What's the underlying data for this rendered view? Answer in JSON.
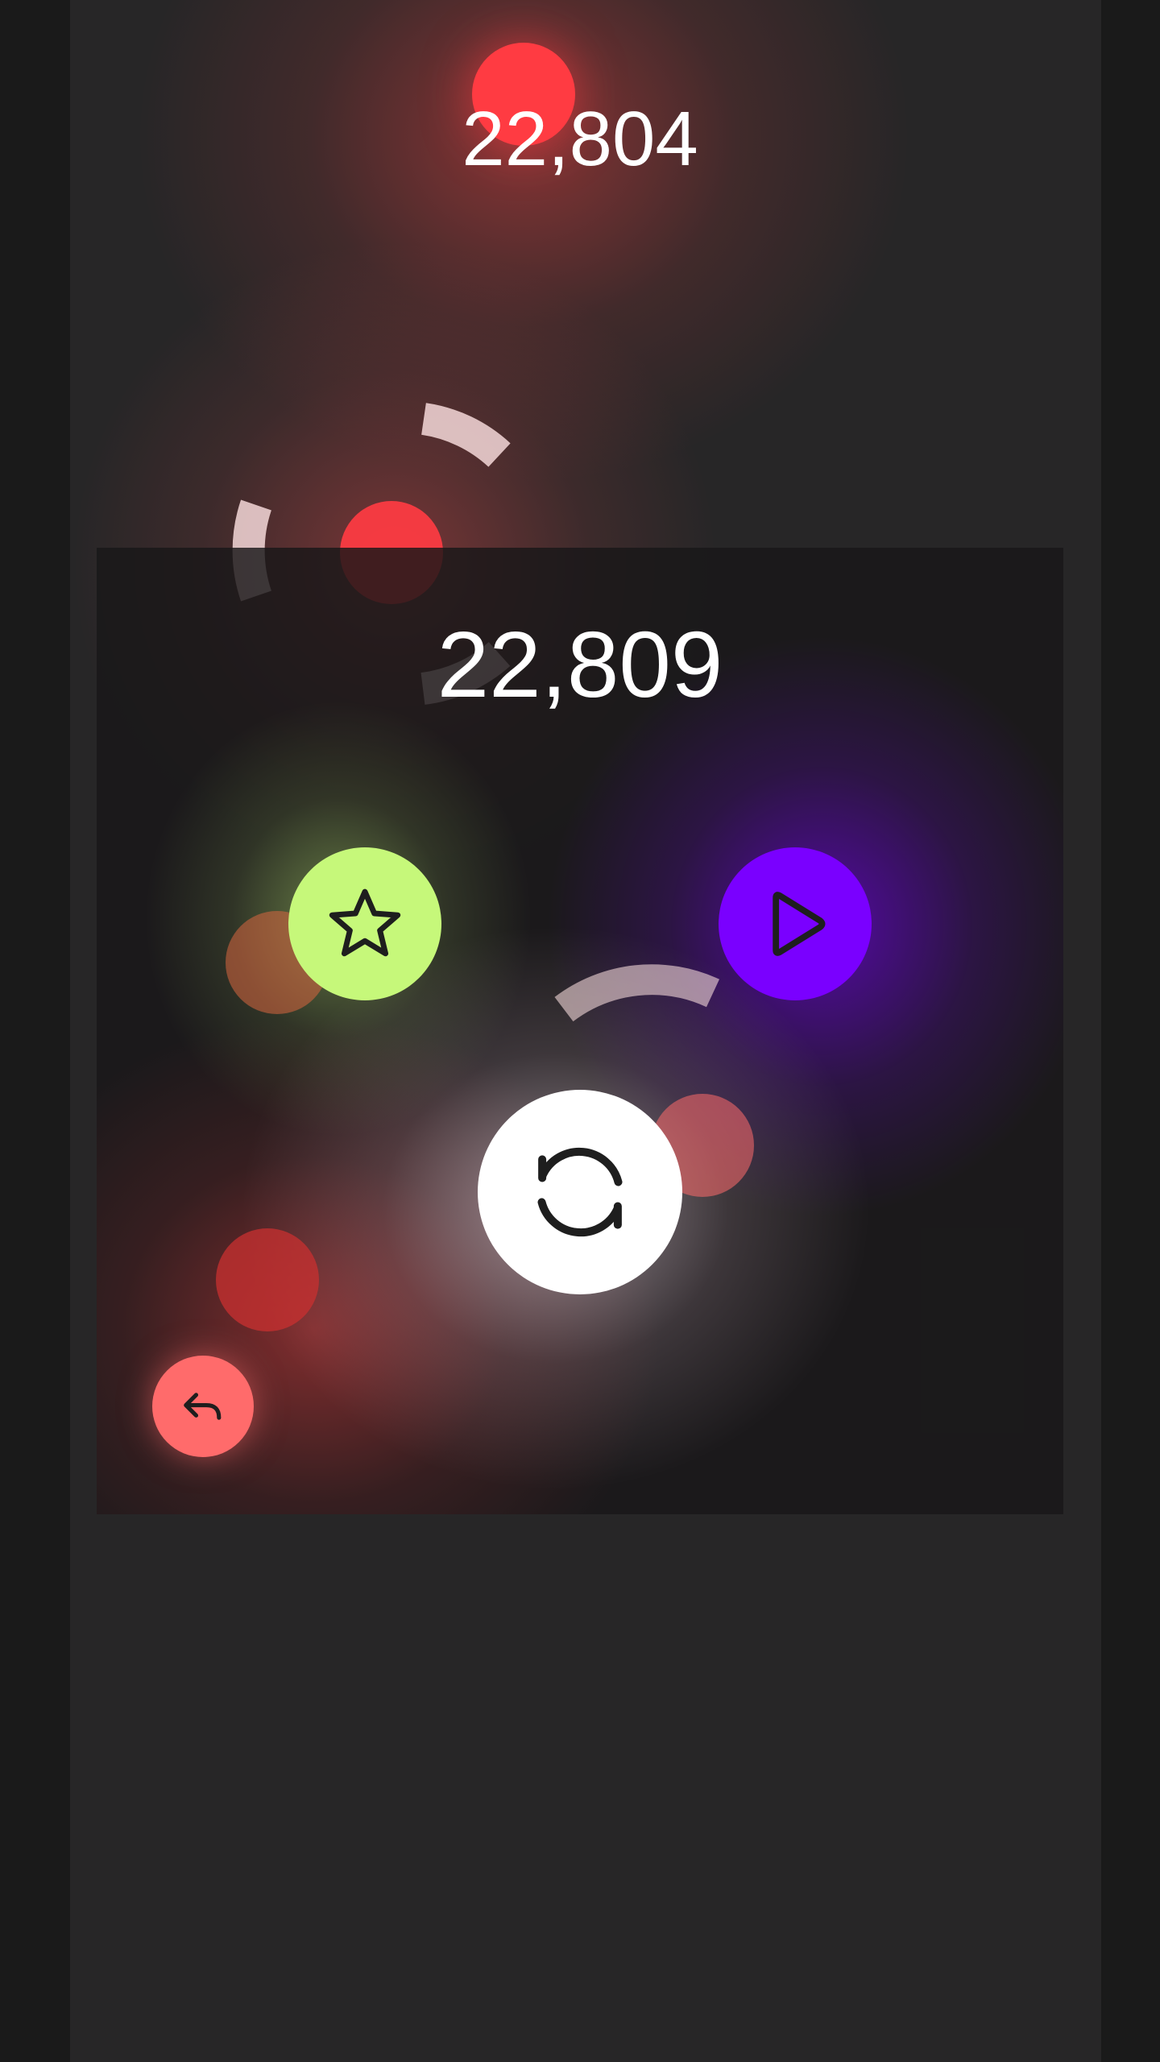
{
  "hud": {
    "live_score": "22,804"
  },
  "game_over": {
    "final_score": "22,809",
    "buttons": {
      "rate": {
        "icon": "star-icon"
      },
      "play": {
        "icon": "play-icon"
      },
      "restart": {
        "icon": "restart-icon"
      },
      "back": {
        "icon": "back-arrow-icon"
      }
    }
  },
  "colors": {
    "background": "#272627",
    "side_bars": "#1a1a1a",
    "player_dot": "#ff3b42",
    "rate_button": "#c6f87a",
    "play_button": "#7a00ff",
    "restart_button": "#ffffff",
    "back_button": "#ff6b6b",
    "icon_stroke": "#1e1e1e",
    "arc_segments": "#f4d8d8"
  }
}
